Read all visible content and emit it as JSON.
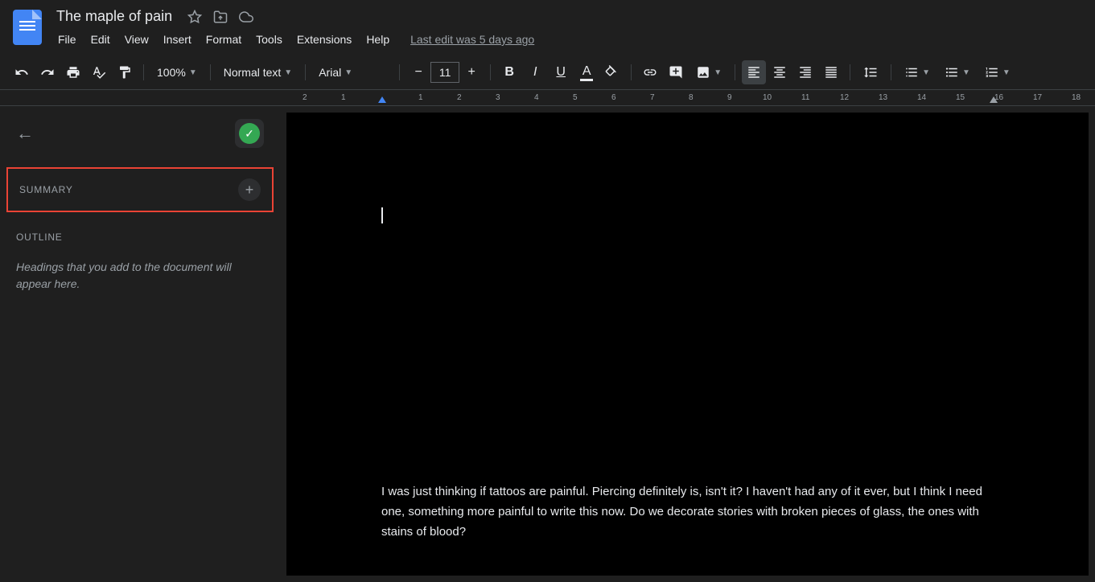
{
  "header": {
    "doc_title": "The maple of pain",
    "menu": {
      "file": "File",
      "edit": "Edit",
      "view": "View",
      "insert": "Insert",
      "format": "Format",
      "tools": "Tools",
      "extensions": "Extensions",
      "help": "Help"
    },
    "last_edit": "Last edit was 5 days ago"
  },
  "toolbar": {
    "zoom": "100%",
    "style": "Normal text",
    "font": "Arial",
    "font_size": "11"
  },
  "ruler": {
    "marks": [
      "2",
      "1",
      "1",
      "2",
      "3",
      "4",
      "5",
      "6",
      "7",
      "8",
      "9",
      "10",
      "11",
      "12",
      "13",
      "14",
      "15",
      "16",
      "17",
      "18"
    ]
  },
  "sidebar": {
    "summary_label": "SUMMARY",
    "outline_label": "OUTLINE",
    "outline_hint": "Headings that you add to the document will appear here."
  },
  "document": {
    "paragraph": "I was just thinking if tattoos are painful. Piercing definitely is, isn't it? I haven't had any of it ever, but I think I need one, something more painful to write this now. Do we decorate stories with broken pieces of glass, the ones with stains of blood?"
  }
}
